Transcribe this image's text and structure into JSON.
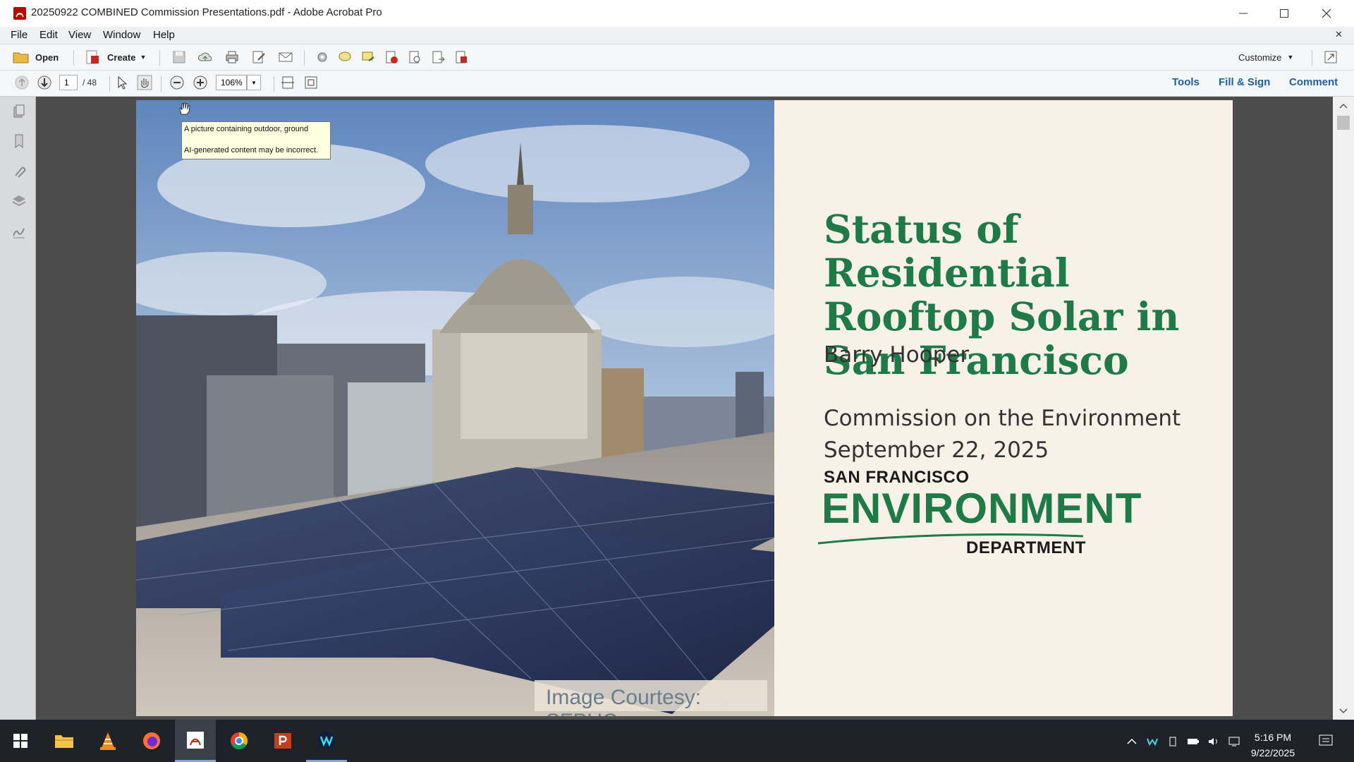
{
  "window": {
    "title": "20250922 COMBINED Commission Presentations.pdf - Adobe Acrobat Pro",
    "controls": [
      "minimize",
      "maximize",
      "close"
    ]
  },
  "menu": [
    "File",
    "Edit",
    "View",
    "Window",
    "Help"
  ],
  "toolbar": {
    "open_label": "Open",
    "create_label": "Create",
    "customize_label": "Customize"
  },
  "nav": {
    "current_page": "1",
    "total_pages": "/ 48",
    "zoom": "106%",
    "tools_label": "Tools",
    "fill_sign_label": "Fill & Sign",
    "comment_label": "Comment"
  },
  "tooltip": {
    "line1": "A picture containing outdoor, ground",
    "line2": "AI-generated content may be incorrect."
  },
  "slide": {
    "title": "Status of Residential Rooftop Solar in San Francisco",
    "presenter": "Barry Hooper",
    "event": "Commission on the Environment",
    "date": "September 22, 2025",
    "caption": "Image Courtesy: SFPUC",
    "logo": {
      "line1": "SAN FRANCISCO",
      "line2": "ENVIRONMENT",
      "line3": "DEPARTMENT"
    }
  },
  "taskbar": {
    "apps": [
      "start-icon",
      "file-explorer-icon",
      "vlc-icon",
      "firefox-icon",
      "acrobat-icon",
      "chrome-icon",
      "powerpoint-icon",
      "webex-icon"
    ],
    "time": "5:16 PM",
    "date": "9/22/2025"
  },
  "colors": {
    "title_green": "#1e7a47",
    "link_blue": "#1f5fa6",
    "page_background": "#f7f1e8"
  }
}
